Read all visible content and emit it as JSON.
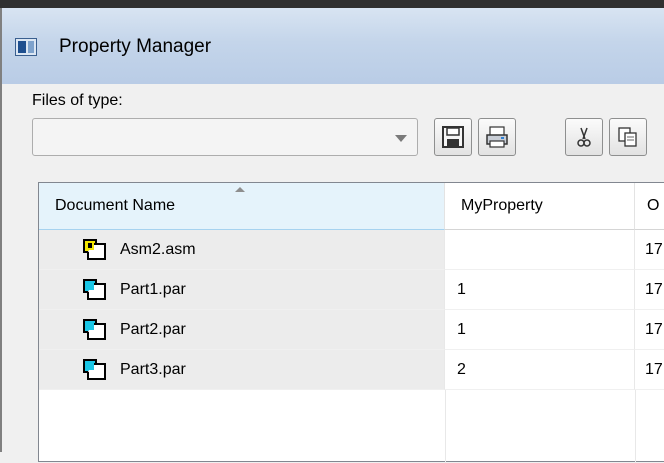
{
  "window": {
    "title": "Property Manager"
  },
  "filter": {
    "label": "Files of type:",
    "value": ""
  },
  "toolbar": {
    "buttons": [
      {
        "name": "save-button",
        "icon": "save-icon"
      },
      {
        "name": "print-button",
        "icon": "print-icon"
      },
      {
        "name": "cut-button",
        "icon": "cut-icon"
      },
      {
        "name": "copy-button",
        "icon": "copy-icon"
      }
    ]
  },
  "grid": {
    "columns": [
      "Document Name",
      "MyProperty",
      "O"
    ],
    "sorted_column": "Document Name",
    "rows": [
      {
        "name": "Asm2.asm",
        "icon": "assembly-file-icon",
        "myproperty": "",
        "third": "17"
      },
      {
        "name": "Part1.par",
        "icon": "part-file-icon",
        "myproperty": "1",
        "third": "17"
      },
      {
        "name": "Part2.par",
        "icon": "part-file-icon",
        "myproperty": "1",
        "third": "17"
      },
      {
        "name": "Part3.par",
        "icon": "part-file-icon",
        "myproperty": "2",
        "third": "17"
      }
    ]
  },
  "colors": {
    "titlebar": "#c4d5ea",
    "selected_header": "#e5f3fb",
    "name_cell": "#ececec",
    "part_icon_cyan": "#19c6e6",
    "assembly_icon_yellow": "#f2e600"
  }
}
